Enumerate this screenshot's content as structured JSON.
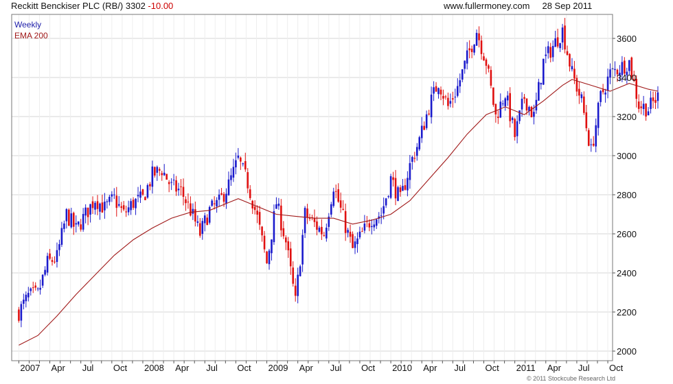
{
  "header": {
    "title": "Reckitt Benckiser PLC (RB/) 3302",
    "change": "-10.00",
    "site": "www.fullermoney.com",
    "date": "28 Sep 2011"
  },
  "legend": {
    "weekly": "Weekly",
    "ema": "EMA 200"
  },
  "copyright": "© 2011 Stockcube Research Ltd",
  "colors": {
    "up": "#1a1acc",
    "down": "#e01010",
    "ema": "#a01818",
    "grid": "#d4d4d4",
    "weekly_text": "#2020aa",
    "ema_text": "#a01818"
  },
  "chart_data": {
    "type": "candlestick",
    "x_ticks": [
      "2007",
      "Apr",
      "Jul",
      "Oct",
      "2008",
      "Apr",
      "Jul",
      "Oct",
      "2009",
      "Apr",
      "Jul",
      "Oct",
      "2010",
      "Apr",
      "Jul",
      "Oct",
      "2011",
      "Apr",
      "Jul",
      "Oct"
    ],
    "y_ticks": [
      2000,
      2200,
      2400,
      2600,
      2800,
      3000,
      3200,
      3400,
      3600
    ],
    "ylim": [
      1950,
      3700
    ],
    "x_range_weeks": [
      -3,
      249
    ],
    "weekly_close": [
      [
        0,
        2200
      ],
      [
        4,
        2280
      ],
      [
        8,
        2290
      ],
      [
        12,
        2450
      ],
      [
        16,
        2480
      ],
      [
        20,
        2700
      ],
      [
        24,
        2620
      ],
      [
        28,
        2700
      ],
      [
        32,
        2780
      ],
      [
        36,
        2730
      ],
      [
        40,
        2780
      ],
      [
        44,
        2700
      ],
      [
        48,
        2760
      ],
      [
        52,
        2780
      ],
      [
        56,
        2900
      ],
      [
        60,
        2930
      ],
      [
        64,
        2840
      ],
      [
        68,
        2820
      ],
      [
        72,
        2720
      ],
      [
        76,
        2600
      ],
      [
        80,
        2720
      ],
      [
        84,
        2760
      ],
      [
        88,
        2850
      ],
      [
        92,
        2980
      ],
      [
        96,
        2860
      ],
      [
        100,
        2680
      ],
      [
        104,
        2450
      ],
      [
        108,
        2760
      ],
      [
        112,
        2560
      ],
      [
        116,
        2250
      ],
      [
        120,
        2700
      ],
      [
        124,
        2650
      ],
      [
        128,
        2600
      ],
      [
        132,
        2850
      ],
      [
        136,
        2680
      ],
      [
        140,
        2520
      ],
      [
        144,
        2600
      ],
      [
        148,
        2680
      ],
      [
        152,
        2700
      ],
      [
        156,
        2880
      ],
      [
        160,
        2770
      ],
      [
        164,
        2950
      ],
      [
        168,
        3080
      ],
      [
        172,
        3250
      ],
      [
        176,
        3380
      ],
      [
        180,
        3250
      ],
      [
        184,
        3350
      ],
      [
        188,
        3500
      ],
      [
        192,
        3640
      ],
      [
        196,
        3480
      ],
      [
        200,
        3200
      ],
      [
        204,
        3320
      ],
      [
        208,
        3100
      ],
      [
        212,
        3300
      ],
      [
        216,
        3200
      ],
      [
        220,
        3480
      ],
      [
        224,
        3560
      ],
      [
        228,
        3640
      ],
      [
        232,
        3420
      ],
      [
        236,
        3280
      ],
      [
        240,
        3020
      ],
      [
        244,
        3300
      ],
      [
        248,
        3420
      ],
      [
        252,
        3450
      ],
      [
        256,
        3480
      ],
      [
        260,
        3260
      ],
      [
        264,
        3240
      ],
      [
        268,
        3302
      ]
    ],
    "ema200": [
      [
        0,
        2030
      ],
      [
        8,
        2080
      ],
      [
        16,
        2180
      ],
      [
        24,
        2290
      ],
      [
        32,
        2390
      ],
      [
        40,
        2490
      ],
      [
        48,
        2570
      ],
      [
        52,
        2600
      ],
      [
        56,
        2630
      ],
      [
        64,
        2680
      ],
      [
        72,
        2710
      ],
      [
        80,
        2720
      ],
      [
        88,
        2760
      ],
      [
        92,
        2780
      ],
      [
        100,
        2740
      ],
      [
        108,
        2700
      ],
      [
        116,
        2690
      ],
      [
        124,
        2680
      ],
      [
        132,
        2680
      ],
      [
        140,
        2650
      ],
      [
        148,
        2670
      ],
      [
        156,
        2700
      ],
      [
        164,
        2770
      ],
      [
        172,
        2880
      ],
      [
        180,
        2990
      ],
      [
        188,
        3110
      ],
      [
        196,
        3210
      ],
      [
        204,
        3250
      ],
      [
        212,
        3210
      ],
      [
        220,
        3280
      ],
      [
        228,
        3360
      ],
      [
        232,
        3390
      ],
      [
        240,
        3360
      ],
      [
        248,
        3330
      ],
      [
        256,
        3370
      ],
      [
        264,
        3340
      ],
      [
        268,
        3330
      ]
    ]
  }
}
